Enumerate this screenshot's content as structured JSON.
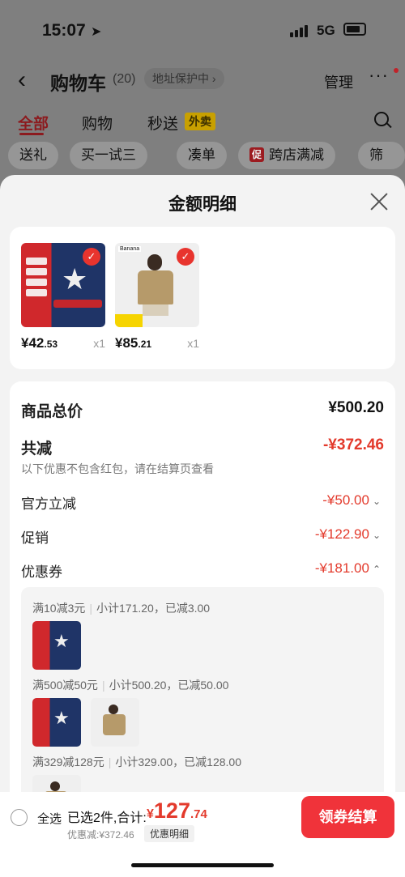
{
  "status": {
    "time": "15:07",
    "network": "5G"
  },
  "header": {
    "title": "购物车",
    "count": "(20)",
    "address": "地址保护中 ›",
    "manage": "管理",
    "more": "···"
  },
  "tabs": [
    {
      "label": "全部",
      "active": true
    },
    {
      "label": "购物"
    },
    {
      "label": "秒送"
    }
  ],
  "tab_badge": "外卖",
  "chips": [
    {
      "label": "送礼"
    },
    {
      "label": "买一试三"
    },
    {
      "label": "凑单"
    },
    {
      "label": "跨店满减",
      "tag": "促"
    },
    {
      "label": "筛选"
    }
  ],
  "sheet": {
    "title": "金额明细",
    "products": [
      {
        "price_main": "¥42",
        "price_dec": ".53",
        "qty": "x1"
      },
      {
        "price_main": "¥85",
        "price_dec": ".21",
        "qty": "x1"
      }
    ],
    "summary": {
      "total_label": "商品总价",
      "total_value": "¥500.20",
      "discount_label": "共减",
      "discount_value": "-¥372.46",
      "discount_note": "以下优惠不包含红包，请在结算页查看",
      "official_label": "官方立减",
      "official_value": "-¥50.00",
      "promo_label": "促销",
      "promo_value": "-¥122.90",
      "coupon_label": "优惠券",
      "coupon_value": "-¥181.00"
    },
    "coupons": [
      {
        "rule": "满10减3元",
        "detail": "小计171.20，已减3.00"
      },
      {
        "rule": "满500减50元",
        "detail": "小计500.20，已减50.00"
      },
      {
        "rule": "满329减128元",
        "detail": "小计329.00，已减128.00"
      }
    ]
  },
  "bottom": {
    "select_all": "全选",
    "selected": "已选2件,合计:",
    "total_cur": "¥",
    "total_main": "127",
    "total_dec": ".74",
    "discount_line": "优惠减:¥372.46",
    "detail_button": "优惠明细",
    "checkout": "领券结算"
  },
  "colors": {
    "accent": "#f0333a",
    "price_red": "#e33a2c",
    "tab_active": "#8c1a1e"
  }
}
